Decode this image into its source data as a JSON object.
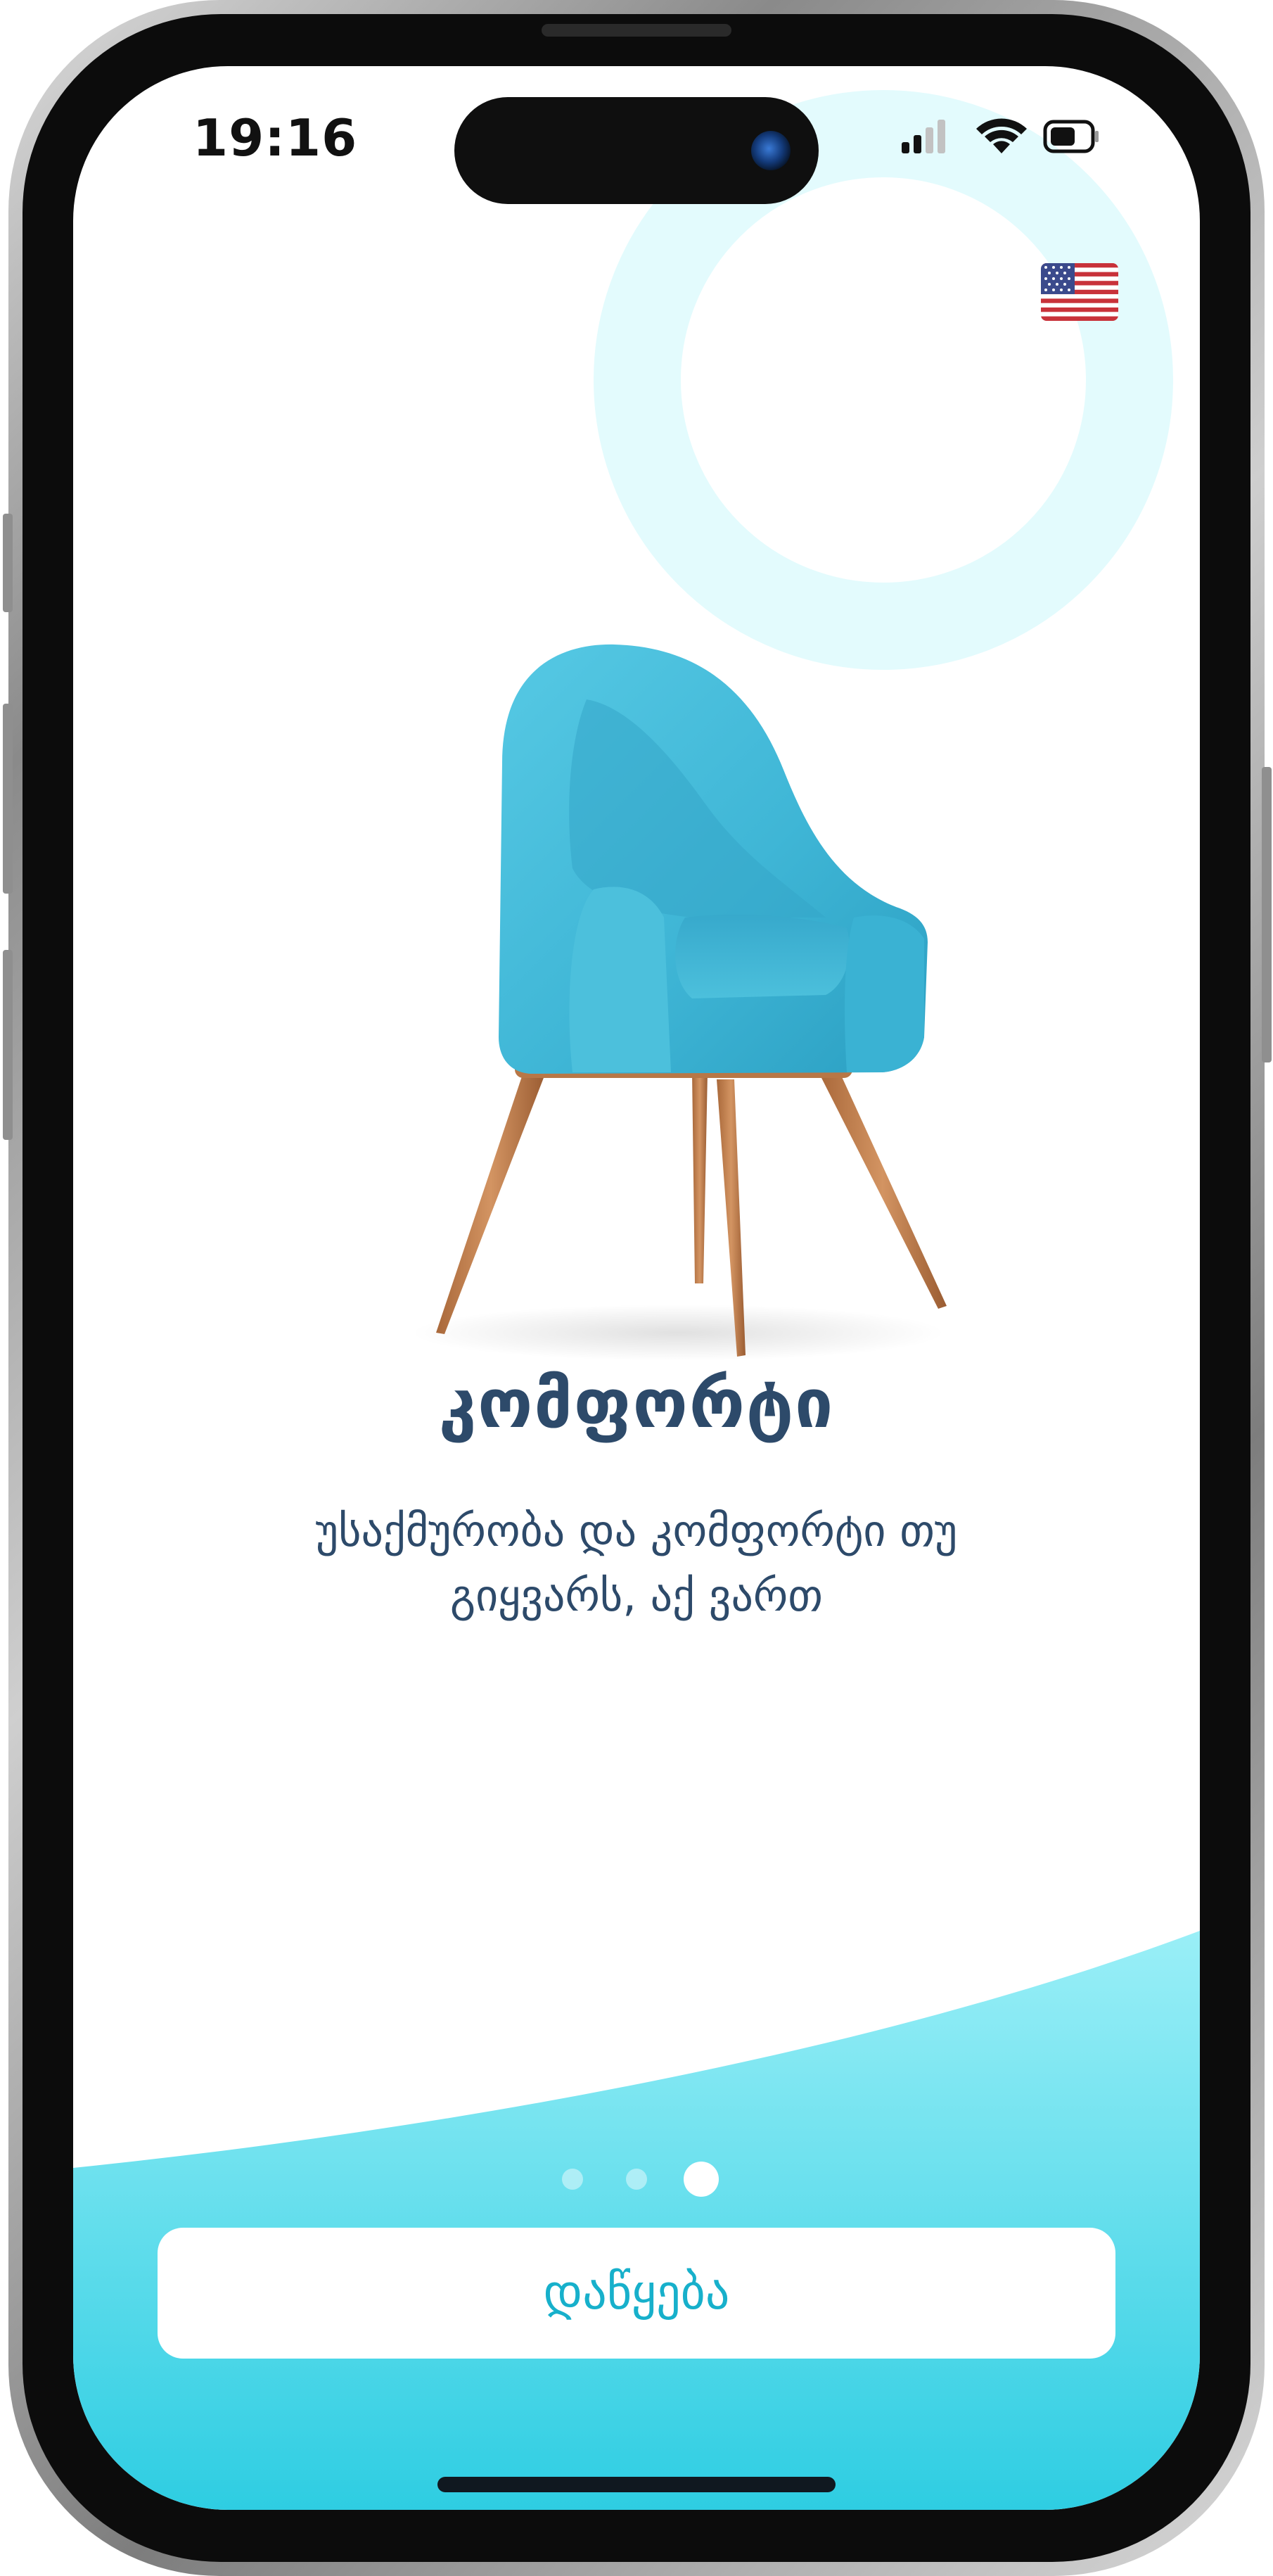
{
  "status_bar": {
    "time": "19:16"
  },
  "language": {
    "current_flag_icon": "us-flag-icon"
  },
  "onboarding": {
    "illustration_icon": "armchair-icon",
    "title": "კომფორტი",
    "description": "უსაქმურობა და კომფორტი თუ გიყვარს, აქ ვართ",
    "pager": {
      "total": 3,
      "current": 3
    },
    "cta_label": "დაწყება"
  },
  "colors": {
    "title_text": "#2d4a6a",
    "accent": "#17b0cb",
    "wave_top": "#9aeff7",
    "wave_bottom": "#2ecde2",
    "ring": "#e3fbfd",
    "chair": "#3fb6d6"
  }
}
